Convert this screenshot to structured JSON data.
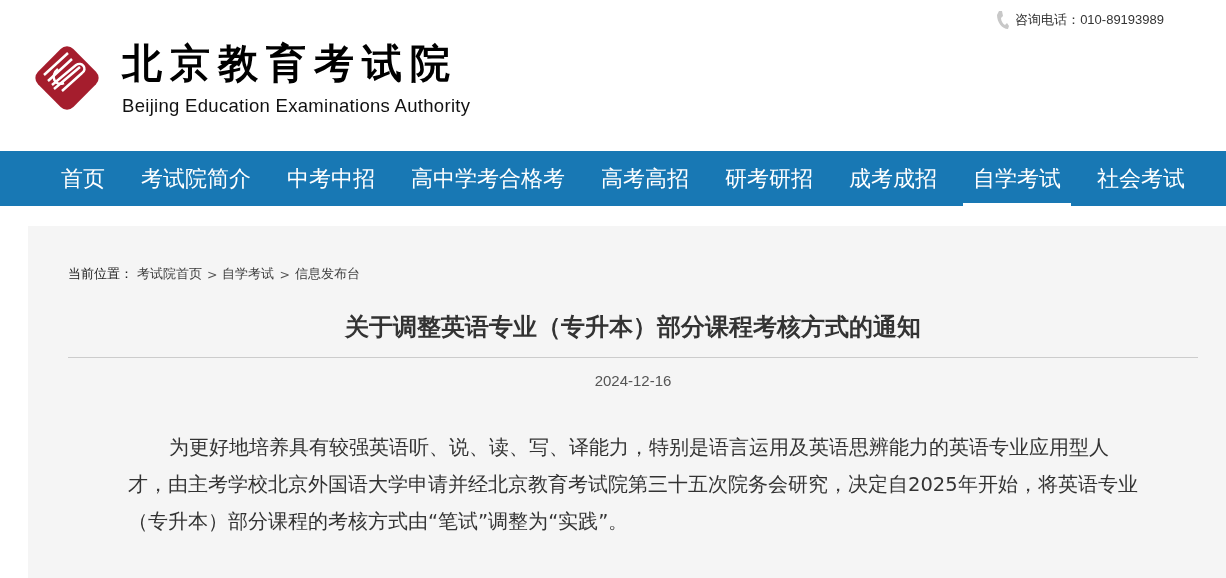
{
  "logo": {
    "title": "北京教育考试院",
    "subtitle": "Beijing Education Examinations Authority"
  },
  "hotline": {
    "label": "咨询电话：010-89193989"
  },
  "nav": [
    {
      "label": "首页",
      "selected": false
    },
    {
      "label": "考试院简介",
      "selected": false
    },
    {
      "label": "中考中招",
      "selected": false
    },
    {
      "label": "高中学考合格考",
      "selected": false
    },
    {
      "label": "高考高招",
      "selected": false
    },
    {
      "label": "研考研招",
      "selected": false
    },
    {
      "label": "成考成招",
      "selected": false
    },
    {
      "label": "自学考试",
      "selected": true
    },
    {
      "label": "社会考试",
      "selected": false
    }
  ],
  "breadcrumb": [
    {
      "kind": "label",
      "text": "当前位置："
    },
    {
      "kind": "link",
      "text": "考试院首页"
    },
    {
      "kind": "sep",
      "text": ">"
    },
    {
      "kind": "link",
      "text": "自学考试"
    },
    {
      "kind": "sep",
      "text": ">"
    },
    {
      "kind": "link",
      "text": "信息发布台"
    }
  ],
  "article": {
    "title": "关于调整英语专业（专升本）部分课程考核方式的通知",
    "date": "2024-12-16",
    "paragraphs": [
      "为更好地培养具有较强英语听、说、读、写、译能力，特别是语言运用及英语思辨能力的英语专业应用型人才，由主考学校北京外国语大学申请并经北京教育考试院第三十五次院务会研究，决定自2025年开始，将英语专业（专升本）部分课程的考核方式由“笔试”调整为“实践”。"
    ]
  }
}
